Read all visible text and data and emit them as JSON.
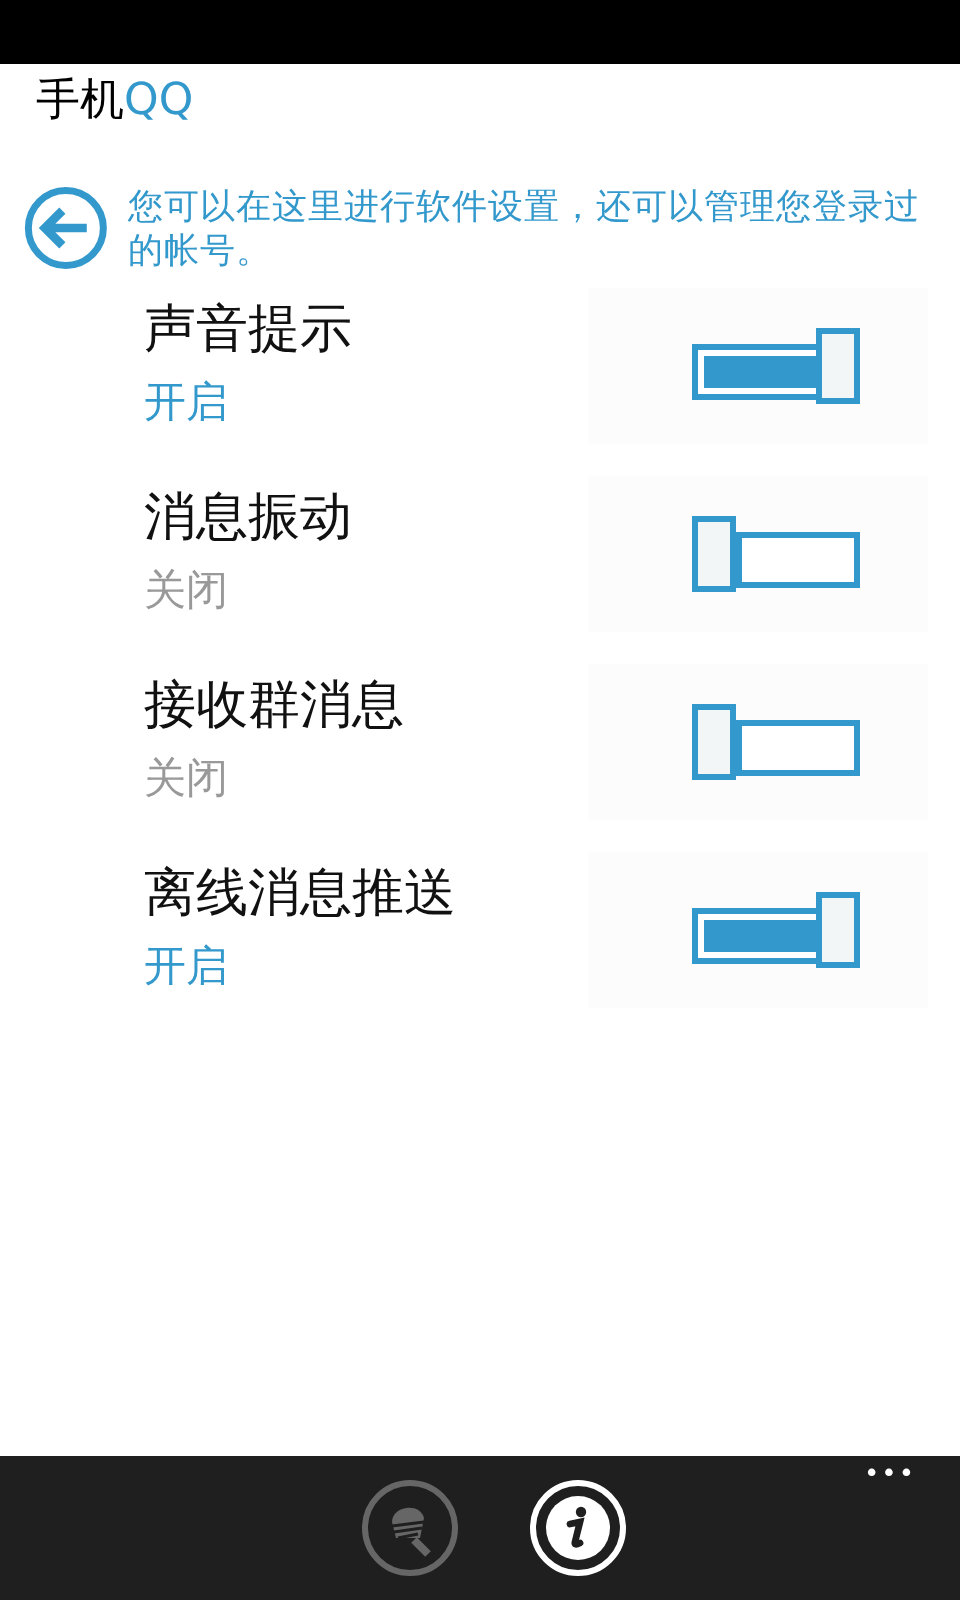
{
  "app_title": {
    "prefix": "手机",
    "brand": "QQ"
  },
  "intro": {
    "text": "您可以在这里进行软件设置，还可以管理您登录过的帐号。"
  },
  "settings": [
    {
      "label": "声音提示",
      "status": "开启",
      "on": true
    },
    {
      "label": "消息振动",
      "status": "关闭",
      "on": false
    },
    {
      "label": "接收群消息",
      "status": "关闭",
      "on": false
    },
    {
      "label": "离线消息推送",
      "status": "开启",
      "on": true
    }
  ],
  "app_bar": {
    "buttons": [
      {
        "kind": "clean",
        "disabled": true
      },
      {
        "kind": "info",
        "disabled": false
      }
    ],
    "more": "•••"
  }
}
